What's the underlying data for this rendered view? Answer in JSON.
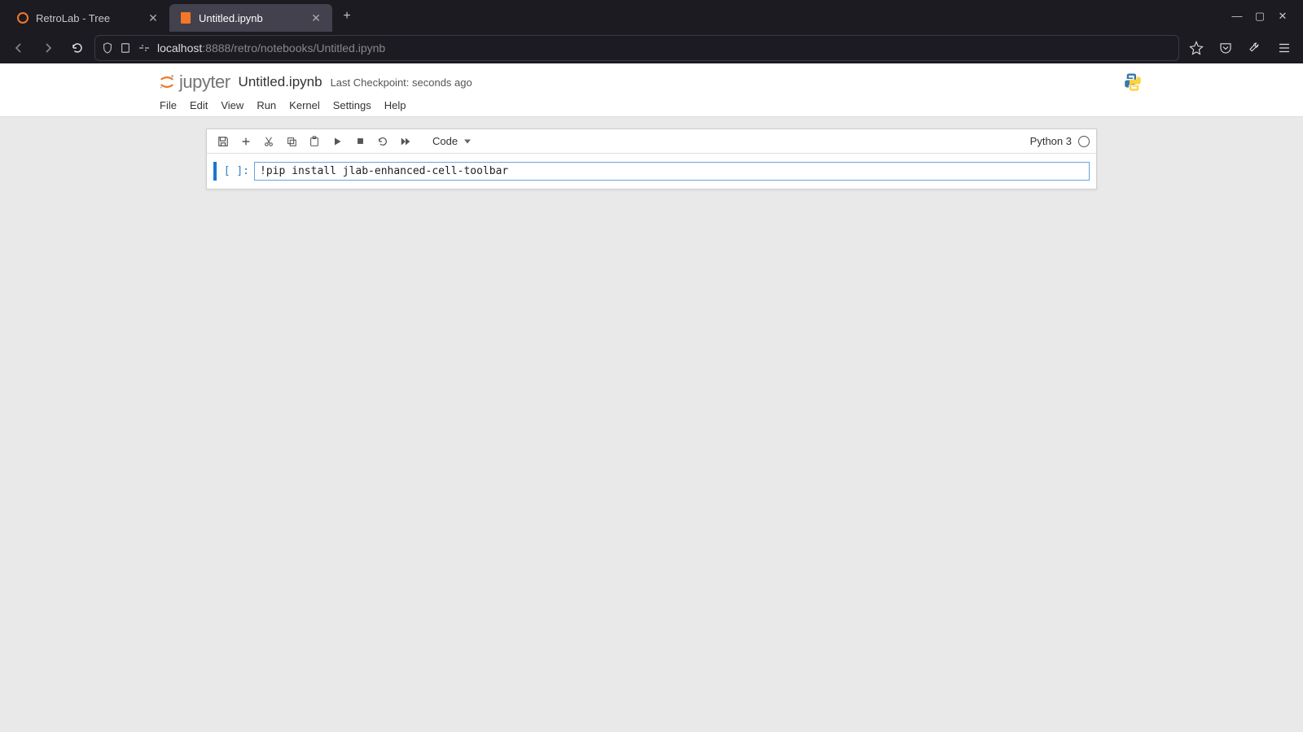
{
  "browser": {
    "tabs": [
      {
        "title": "RetroLab - Tree",
        "active": false
      },
      {
        "title": "Untitled.ipynb",
        "active": true
      }
    ],
    "address": {
      "host": "localhost",
      "port": ":8888",
      "path": "/retro/notebooks/Untitled.ipynb"
    }
  },
  "jupyter": {
    "logo_text": "jupyter",
    "notebook_name": "Untitled.ipynb",
    "checkpoint": "Last Checkpoint: seconds ago",
    "menus": [
      "File",
      "Edit",
      "View",
      "Run",
      "Kernel",
      "Settings",
      "Help"
    ],
    "toolbar": {
      "cell_type": "Code",
      "kernel_label": "Python 3"
    },
    "cell": {
      "prompt": "[ ]:",
      "source": "!pip install jlab-enhanced-cell-toolbar"
    }
  }
}
